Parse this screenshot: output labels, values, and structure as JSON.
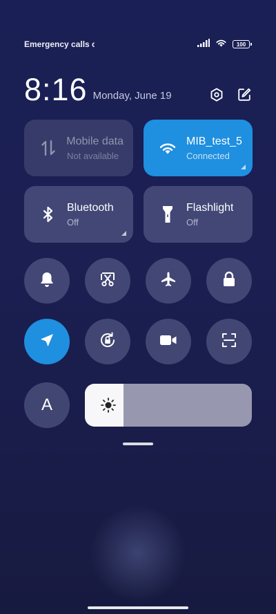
{
  "status": {
    "text": "Emergency calls o",
    "battery": "100"
  },
  "clock": {
    "time": "8:16",
    "date": "Monday, June 19"
  },
  "tiles": {
    "mobile": {
      "label": "Mobile data",
      "sub": "Not available"
    },
    "wifi": {
      "label": "MIB_test_5",
      "sub": "Connected"
    },
    "bluetooth": {
      "label": "Bluetooth",
      "sub": "Off"
    },
    "flashlight": {
      "label": "Flashlight",
      "sub": "Off"
    }
  },
  "font_button": "A",
  "brightness": {
    "level": 0.23
  },
  "colors": {
    "accent": "#1f8fe0",
    "background": "#1a1f55"
  }
}
